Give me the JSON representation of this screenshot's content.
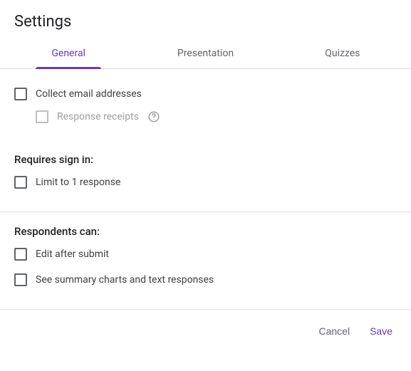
{
  "title": "Settings",
  "tabs": {
    "general": "General",
    "presentation": "Presentation",
    "quizzes": "Quizzes"
  },
  "options": {
    "collect_email": "Collect email addresses",
    "response_receipts": "Response receipts"
  },
  "requires_signin": {
    "title": "Requires sign in:",
    "limit": "Limit to 1 response"
  },
  "respondents_can": {
    "title": "Respondents can:",
    "edit": "Edit after submit",
    "summary": "See summary charts and text responses"
  },
  "actions": {
    "cancel": "Cancel",
    "save": "Save"
  }
}
